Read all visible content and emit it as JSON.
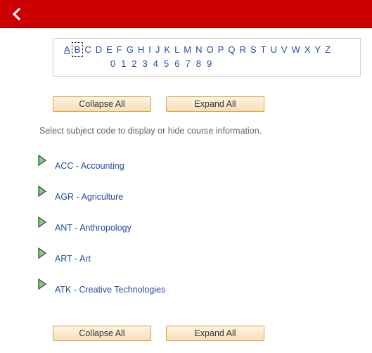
{
  "header": {
    "back_icon": "chevron-left-icon",
    "background_color": "#cc0000"
  },
  "alpha_nav": {
    "letters": [
      {
        "label": "A",
        "state": "visited"
      },
      {
        "label": "B",
        "state": "focused"
      },
      {
        "label": "C",
        "state": "normal"
      },
      {
        "label": "D",
        "state": "normal"
      },
      {
        "label": "E",
        "state": "normal"
      },
      {
        "label": "F",
        "state": "normal"
      },
      {
        "label": "G",
        "state": "normal"
      },
      {
        "label": "H",
        "state": "normal"
      },
      {
        "label": "I",
        "state": "normal"
      },
      {
        "label": "J",
        "state": "normal"
      },
      {
        "label": "K",
        "state": "normal"
      },
      {
        "label": "L",
        "state": "normal"
      },
      {
        "label": "M",
        "state": "normal"
      },
      {
        "label": "N",
        "state": "normal"
      },
      {
        "label": "O",
        "state": "normal"
      },
      {
        "label": "P",
        "state": "normal"
      },
      {
        "label": "Q",
        "state": "normal"
      },
      {
        "label": "R",
        "state": "normal"
      },
      {
        "label": "S",
        "state": "normal"
      },
      {
        "label": "T",
        "state": "normal"
      },
      {
        "label": "U",
        "state": "normal"
      },
      {
        "label": "V",
        "state": "normal"
      },
      {
        "label": "W",
        "state": "normal"
      },
      {
        "label": "X",
        "state": "normal"
      },
      {
        "label": "Y",
        "state": "normal"
      },
      {
        "label": "Z",
        "state": "normal"
      }
    ],
    "digits": [
      "0",
      "1",
      "2",
      "3",
      "4",
      "5",
      "6",
      "7",
      "8",
      "9"
    ],
    "link_color": "#1f4e9c"
  },
  "toolbar_top": {
    "collapse_label": "Collapse All",
    "expand_label": "Expand All"
  },
  "toolbar_bottom": {
    "collapse_label": "Collapse All",
    "expand_label": "Expand All"
  },
  "instruction": {
    "text": "Select subject code to display or hide course information."
  },
  "subjects": [
    {
      "label": "ACC - Accounting",
      "icon": "expand-arrow-icon"
    },
    {
      "label": "AGR - Agriculture",
      "icon": "expand-arrow-icon"
    },
    {
      "label": "ANT - Anthropology",
      "icon": "expand-arrow-icon"
    },
    {
      "label": "ART - Art",
      "icon": "expand-arrow-icon"
    },
    {
      "label": "ATK - Creative Technologies",
      "icon": "expand-arrow-icon"
    }
  ]
}
